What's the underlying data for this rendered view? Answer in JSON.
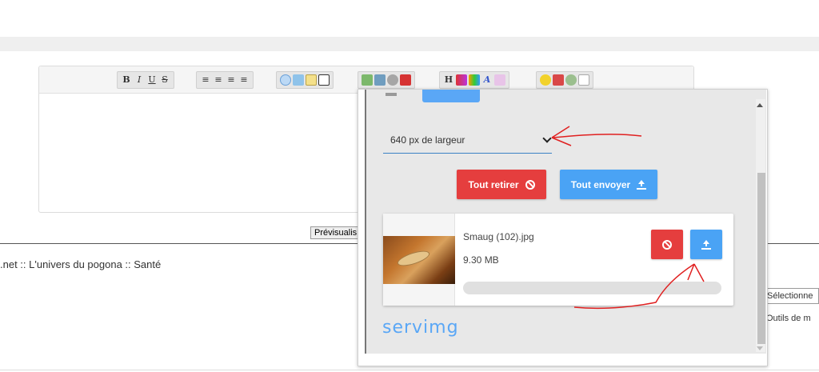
{
  "toolbar": {
    "groups": [
      {
        "name": "text-format",
        "buttons": [
          "B",
          "I",
          "U",
          "S"
        ]
      },
      {
        "name": "align",
        "buttons": [
          "≡",
          "≡",
          "≡",
          "≡"
        ]
      },
      {
        "name": "insert",
        "buttons": [
          "",
          "",
          "",
          ""
        ]
      },
      {
        "name": "media",
        "buttons": [
          "",
          "",
          "",
          ""
        ]
      },
      {
        "name": "style",
        "buttons": [
          "H",
          "",
          "",
          "A",
          ""
        ]
      },
      {
        "name": "misc",
        "buttons": [
          "",
          "",
          "",
          ""
        ]
      }
    ]
  },
  "preview_button": {
    "label": "Prévisualis"
  },
  "breadcrumb": {
    "text": ".net :: L'univers du pogona :: Santé"
  },
  "footer": {
    "select_label": "Sélectionne",
    "tools_label": "Outils de m"
  },
  "uploader": {
    "width_select": {
      "value": "640 px de largeur"
    },
    "remove_all_label": "Tout retirer",
    "send_all_label": "Tout envoyer",
    "file": {
      "name": "Smaug (102).jpg",
      "size": "9.30 MB",
      "progress": 0
    },
    "brand": "servimg"
  },
  "colors": {
    "red": "#e53e3e",
    "blue": "#4aa3f5",
    "annotation": "#e02020"
  }
}
